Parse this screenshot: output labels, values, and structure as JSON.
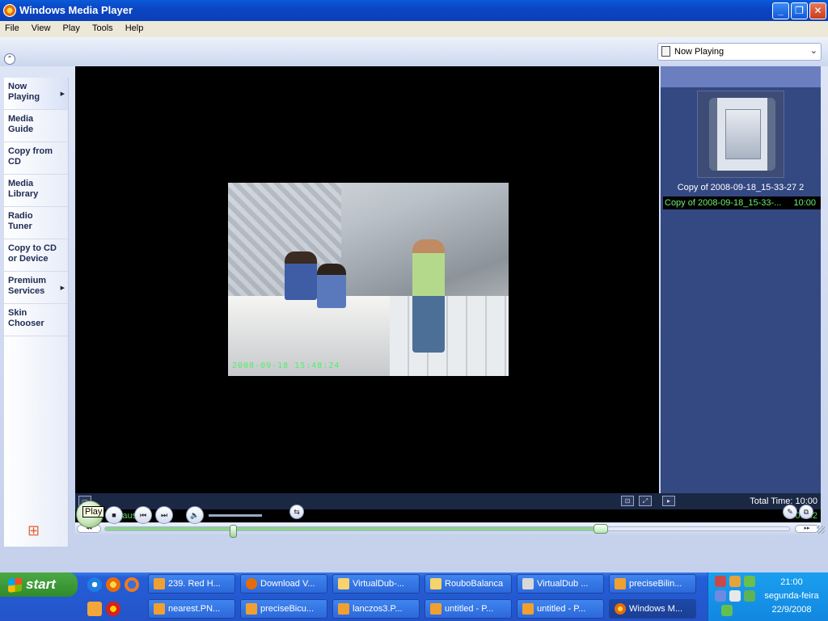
{
  "window": {
    "title": "Windows Media Player",
    "min_glyph": "_",
    "max_glyph": "❐",
    "close_glyph": "✕",
    "icon": "media-player-icon"
  },
  "menu": [
    "File",
    "View",
    "Play",
    "Tools",
    "Help"
  ],
  "now_playing_selector": "Now Playing",
  "nav": [
    {
      "label_1": "Now",
      "label_2": "Playing",
      "has_arrow": true,
      "active": true
    },
    {
      "label_1": "Media",
      "label_2": "Guide"
    },
    {
      "label_1": "Copy from",
      "label_2": "CD"
    },
    {
      "label_1": "Media",
      "label_2": "Library"
    },
    {
      "label_1": "Radio",
      "label_2": "Tuner"
    },
    {
      "label_1": "Copy to CD",
      "label_2": "or Device"
    },
    {
      "label_1": "Premium",
      "label_2": "Services",
      "has_arrow": true
    },
    {
      "label_1": "Skin",
      "label_2": "Chooser"
    }
  ],
  "video": {
    "overlay_timestamp": "2008-09-18 15:48:24"
  },
  "playlist": {
    "title": "Copy of 2008-09-18_15-33-27  2",
    "items": [
      {
        "name": "Copy of 2008-09-18_15-33-...",
        "duration": "10:00",
        "selected": true
      }
    ],
    "text_color": "#69f06d"
  },
  "info": {
    "total_time": "Total Time: 10:00"
  },
  "status": {
    "state": "Paused",
    "elapsed": "06:52",
    "progress_fraction": 0.725,
    "color": "#5ad35f"
  },
  "controls": {
    "play_tooltip": "Play",
    "stop": "■",
    "prev": "⏮",
    "next": "⏭",
    "mute": "🔈",
    "volume_fraction": 0.45,
    "shuffle": "⇆",
    "seek_back": "◂◂",
    "seek_forward": "▸▸"
  },
  "taskbar": {
    "start_label": "start",
    "tasks_row1": [
      {
        "label": "239. Red H...",
        "icon_color": "#f0a030"
      },
      {
        "label": "Download V...",
        "icon_color": "#e86b0a"
      },
      {
        "label": "VirtualDub-...",
        "icon_color": "#f7d36b"
      },
      {
        "label": "RouboBalanca",
        "icon_color": "#f7d36b"
      },
      {
        "label": "VirtualDub ...",
        "icon_color": "#d8d8d8"
      },
      {
        "label": "preciseBilin...",
        "icon_color": "#f0a030"
      }
    ],
    "tasks_row2": [
      {
        "label": "nearest.PN...",
        "icon_color": "#f0a030"
      },
      {
        "label": "preciseBicu...",
        "icon_color": "#f0a030"
      },
      {
        "label": "lanczos3.P...",
        "icon_color": "#f0a030"
      },
      {
        "label": "untitled - P...",
        "icon_color": "#f0a030"
      },
      {
        "label": "untitled - P...",
        "icon_color": "#f0a030"
      },
      {
        "label": "Windows M...",
        "icon_color": "#e86b0a",
        "active": true
      }
    ],
    "clock_time": "21:00",
    "clock_day": "segunda-feira",
    "clock_date": "22/9/2008"
  }
}
